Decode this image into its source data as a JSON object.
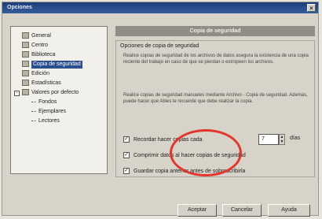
{
  "window": {
    "title": "Opciones",
    "close_glyph": "×"
  },
  "tree": {
    "items": [
      {
        "label": "General",
        "icon": "gear-icon"
      },
      {
        "label": "Centro",
        "icon": "globe-icon"
      },
      {
        "label": "Biblioteca",
        "icon": "book-icon"
      },
      {
        "label": "Copia de seguridad",
        "icon": "disk-icon",
        "selected": true
      },
      {
        "label": "Edición",
        "icon": "pencil-icon"
      },
      {
        "label": "Estadísticas",
        "icon": "chart-icon"
      },
      {
        "label": "Valores por defecto",
        "icon": "folder-icon"
      }
    ],
    "subitems": [
      "Fondos",
      "Ejemplares",
      "Lectores"
    ]
  },
  "panel": {
    "header": "Copia de seguridad",
    "group_title": "Opciones de copia de seguridad",
    "para1": "Realice copias de seguridad de los archivos de datos asegura la existencia de una copia reciente del trabajo en caso de que se pierdan o estropeen los archivos.",
    "para2": "Realice copias de seguridad manuales mediante Archivo - Copia de seguridad. Además, puede hacer que Abies le recuerde que debe realizar la copia.",
    "options": [
      {
        "label": "Recordar hacer copias cada",
        "checked": true
      },
      {
        "label": "Comprimir datos al hacer copias de seguridad",
        "checked": true
      },
      {
        "label": "Guardar copia anterior antes de sobrescribirla",
        "checked": true
      }
    ],
    "interval_value": "7",
    "interval_unit": "días"
  },
  "buttons": {
    "accept": "Aceptar",
    "cancel": "Cancelar",
    "help": "Ayuda"
  },
  "colors": {
    "title_bar": "#1d3e7a",
    "selection": "#2b4f8e",
    "highlight_ellipse": "#e2352c"
  }
}
